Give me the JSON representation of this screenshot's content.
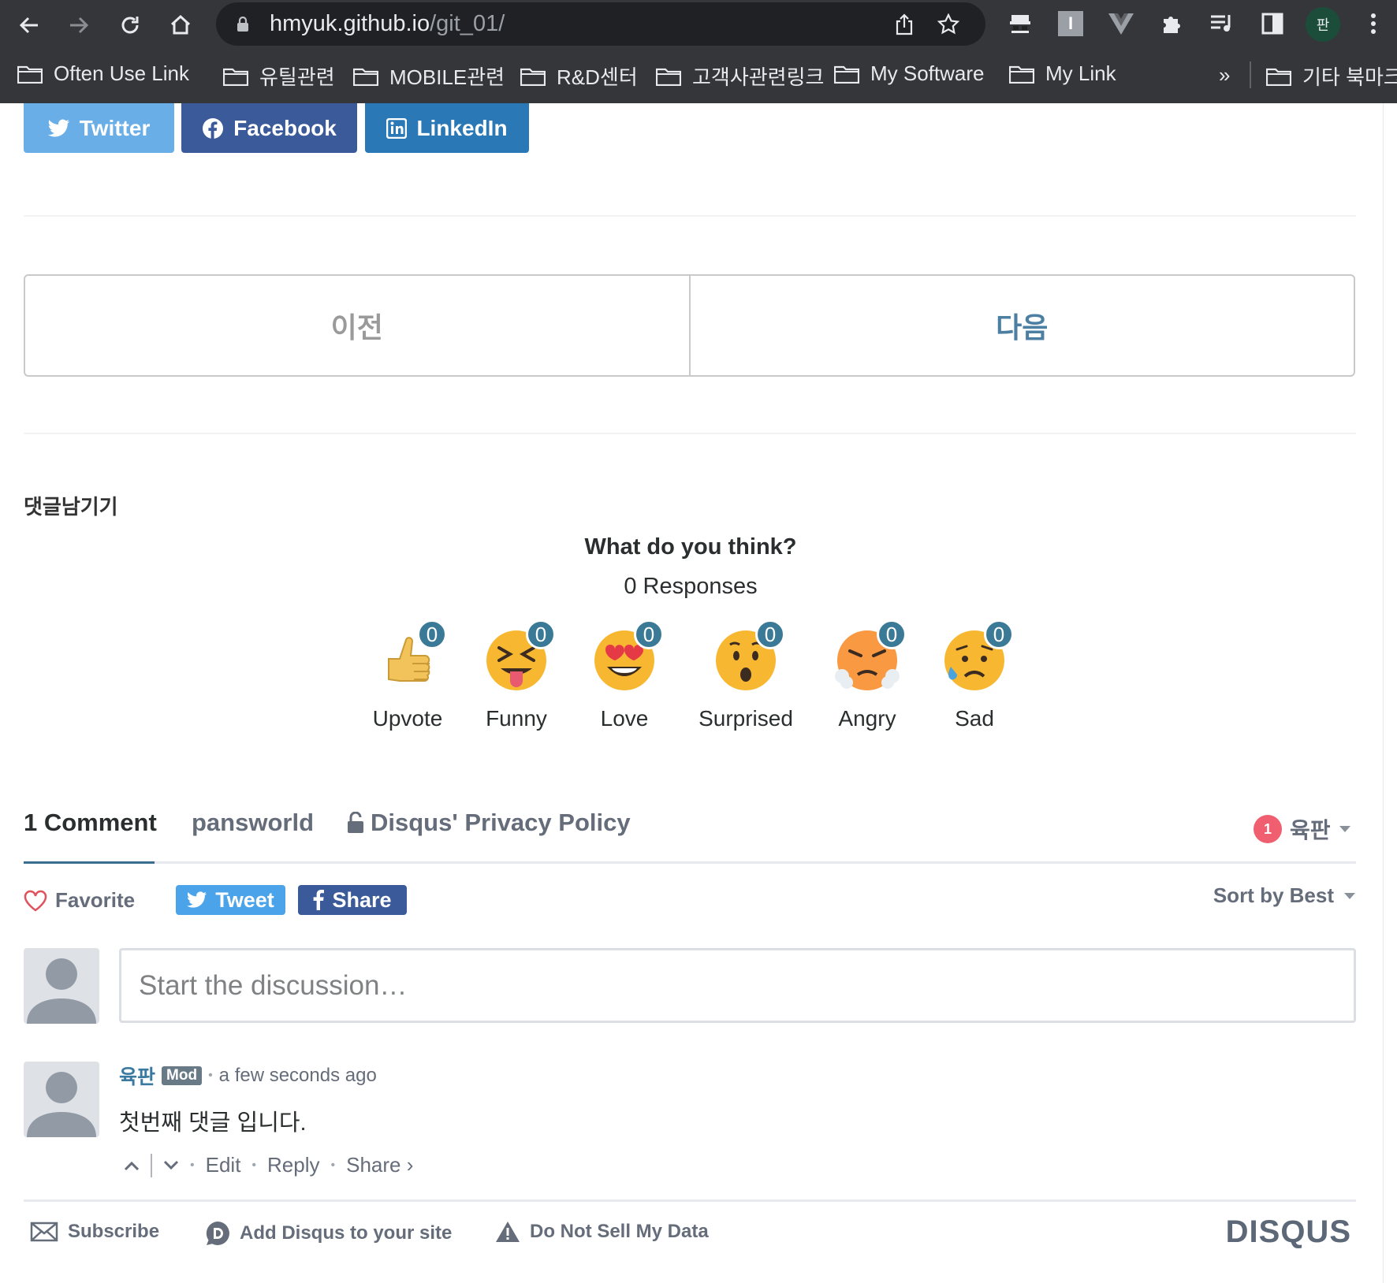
{
  "browser": {
    "url_host": "hmyuk.github.io",
    "url_path": "/git_01/",
    "profile_initial": "판",
    "bookmarks": [
      "Often Use  Link",
      "유틸관련",
      "MOBILE관련",
      "R&D센터",
      "고객사관련링크",
      "My Software",
      "My Link"
    ],
    "overflow": "»",
    "other_bookmarks": "기타 북마크"
  },
  "share_buttons": {
    "twitter": "Twitter",
    "facebook": "Facebook",
    "linkedin": "LinkedIn"
  },
  "pager": {
    "prev": "이전",
    "next": "다음"
  },
  "comment_heading": "댓글남기기",
  "reactions": {
    "title": "What do you think?",
    "responses": "0 Responses",
    "items": [
      {
        "label": "Upvote",
        "count": "0"
      },
      {
        "label": "Funny",
        "count": "0"
      },
      {
        "label": "Love",
        "count": "0"
      },
      {
        "label": "Surprised",
        "count": "0"
      },
      {
        "label": "Angry",
        "count": "0"
      },
      {
        "label": "Sad",
        "count": "0"
      }
    ]
  },
  "disqus": {
    "tabs": {
      "comments": "1 Comment",
      "community": "pansworld",
      "privacy": "Disqus' Privacy Policy"
    },
    "notifications": "1",
    "username": "육판",
    "favorite": "Favorite",
    "tweet": "Tweet",
    "share": "Share",
    "sort": "Sort by Best",
    "placeholder": "Start the discussion…",
    "post": {
      "author": "육판",
      "badge": "Mod",
      "time": "a few seconds ago",
      "body": "첫번째 댓글 입니다.",
      "edit": "Edit",
      "reply": "Reply",
      "share": "Share ›"
    },
    "footer": {
      "subscribe": "Subscribe",
      "add": "Add Disqus to your site",
      "dnsmd": "Do Not Sell My Data",
      "logo": "DISQUS"
    }
  },
  "colors": {
    "twitter": "#6aaee8",
    "facebook": "#3b5a9a",
    "linkedin": "#2a78b5",
    "accent": "#3a6e8f"
  }
}
